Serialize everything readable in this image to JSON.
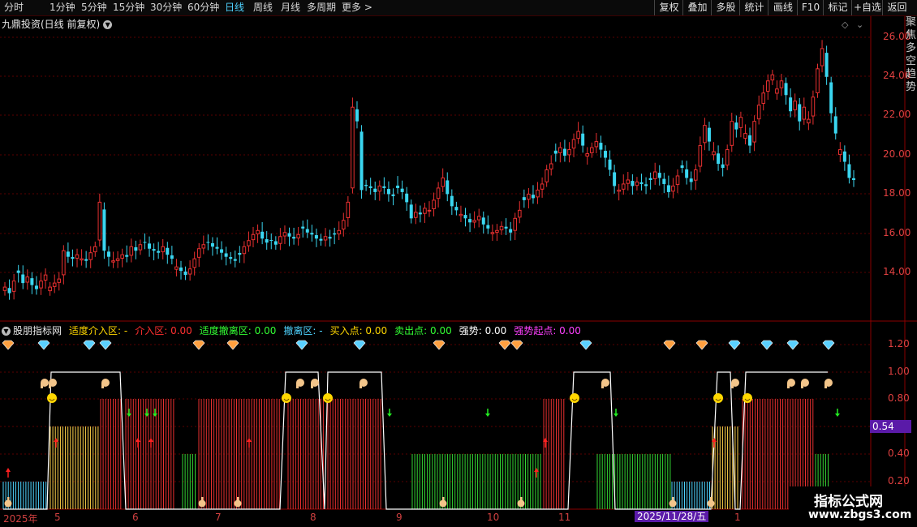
{
  "toolbar": {
    "left": [
      "分时",
      "1分钟",
      "5分钟",
      "15分钟",
      "30分钟",
      "60分钟",
      "日线",
      "周线",
      "月线",
      "多周期",
      "更多 >"
    ],
    "active": "日线",
    "right": [
      "复权",
      "叠加",
      "多股",
      "统计",
      "画线",
      "F10",
      "标记",
      "+自选",
      "返回"
    ]
  },
  "title": "九鼎投资(日线 前复权)",
  "price_axis": [
    "26.00",
    "24.00",
    "22.00",
    "20.00",
    "18.00",
    "16.00",
    "14.00"
  ],
  "side_text": "聚焦多空趋势",
  "indicator": {
    "name": "股朋指标网",
    "items": [
      {
        "label": "适度介入区: -",
        "color": "#ffd700"
      },
      {
        "label": "介入区: 0.00",
        "color": "#ff3030"
      },
      {
        "label": "适度撤离区: 0.00",
        "color": "#33ff33"
      },
      {
        "label": "撤离区: -",
        "color": "#4fd3ff"
      },
      {
        "label": "买入点: 0.00",
        "color": "#ffd700"
      },
      {
        "label": "卖出点: 0.00",
        "color": "#33ff33"
      },
      {
        "label": "强势: 0.00",
        "color": "#ffffff"
      },
      {
        "label": "强势起点: 0.00",
        "color": "#ff40ff"
      }
    ],
    "axis": [
      "1.20",
      "1.00",
      "0.80",
      "0.60",
      "0.40",
      "0.20"
    ],
    "current_value": "0.54"
  },
  "dates": {
    "labels": [
      "2025年",
      "5",
      "6",
      "7",
      "8",
      "9",
      "10",
      "11",
      "1"
    ],
    "highlight": "2025/11/28/五"
  },
  "watermark": {
    "line1": "指标公式网",
    "line2": "www.zbgs3.com"
  },
  "colors": {
    "up": "#e83030",
    "down": "#3ad6f0",
    "grid": "#5a0000",
    "bg": "#000000"
  },
  "chart_data": {
    "type": "candlestick",
    "ylim": [
      12.0,
      27.0
    ],
    "closes": [
      13.6,
      13.3,
      13.9,
      14.3,
      13.8,
      14.1,
      13.7,
      13.5,
      13.9,
      14.2,
      13.6,
      13.8,
      14.0,
      15.4,
      15.1,
      15.0,
      15.2,
      15.0,
      14.9,
      15.3,
      15.6,
      17.8,
      15.4,
      15.1,
      14.9,
      15.0,
      15.2,
      15.1,
      15.6,
      15.4,
      15.7,
      15.8,
      15.5,
      15.4,
      15.3,
      15.6,
      15.2,
      15.0,
      14.6,
      14.4,
      14.2,
      14.5,
      15.0,
      15.5,
      15.7,
      15.8,
      15.6,
      15.5,
      15.3,
      15.1,
      15.0,
      14.9,
      15.2,
      15.6,
      15.9,
      16.2,
      16.4,
      16.0,
      15.8,
      15.9,
      15.7,
      16.1,
      16.3,
      16.1,
      16.0,
      16.2,
      16.5,
      16.3,
      16.2,
      16.0,
      15.9,
      16.1,
      16.0,
      16.2,
      16.4,
      16.9,
      17.8,
      22.5,
      21.8,
      18.4,
      18.6,
      18.5,
      18.3,
      18.6,
      18.5,
      18.2,
      18.1,
      18.5,
      18.3,
      17.8,
      17.0,
      17.3,
      17.2,
      17.5,
      17.4,
      17.9,
      18.5,
      19.0,
      18.2,
      17.6,
      17.4,
      17.2,
      17.0,
      16.8,
      16.9,
      17.1,
      16.7,
      16.5,
      16.3,
      16.4,
      16.6,
      16.5,
      16.3,
      17.0,
      17.4,
      17.9,
      18.2,
      18.0,
      18.4,
      18.7,
      19.4,
      19.7,
      20.2,
      20.5,
      20.1,
      20.4,
      20.9,
      21.3,
      20.6,
      20.2,
      20.5,
      20.8,
      20.4,
      20.0,
      19.4,
      18.6,
      18.4,
      18.7,
      18.9,
      18.6,
      18.8,
      18.7,
      18.6,
      18.9,
      19.3,
      19.0,
      18.7,
      18.3,
      18.6,
      19.1,
      19.5,
      19.0,
      18.8,
      19.4,
      20.6,
      21.6,
      20.8,
      20.3,
      19.7,
      19.5,
      20.4,
      21.8,
      21.4,
      22.0,
      21.2,
      20.6,
      21.8,
      22.6,
      23.2,
      23.8,
      24.1,
      23.4,
      23.8,
      23.1,
      22.3,
      22.8,
      21.8,
      22.5,
      21.9,
      23.0,
      24.4,
      25.4,
      24.0,
      22.2,
      21.2,
      20.4,
      19.8,
      19.0,
      18.9
    ]
  }
}
